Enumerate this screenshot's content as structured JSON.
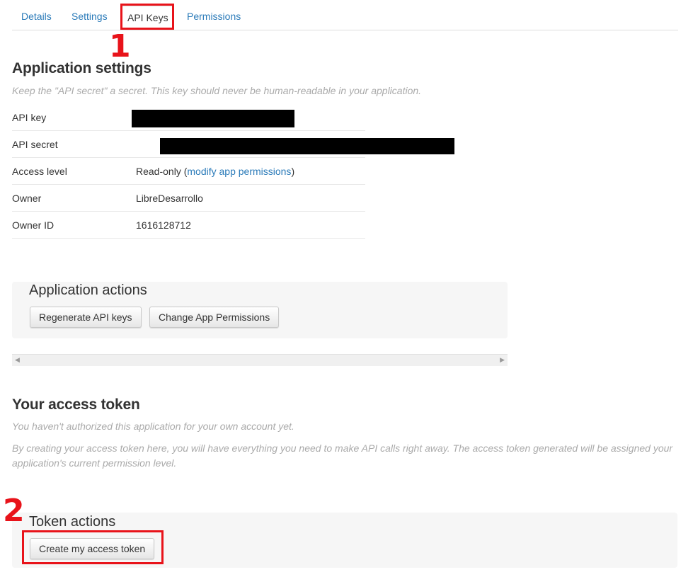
{
  "tabs": [
    {
      "label": "Details"
    },
    {
      "label": "Settings"
    },
    {
      "label": "API Keys",
      "active": true
    },
    {
      "label": "Permissions"
    }
  ],
  "annotations": {
    "step1": "1",
    "step2": "2"
  },
  "app_settings": {
    "title": "Application settings",
    "hint": "Keep the \"API secret\" a secret. This key should never be human-readable in your application.",
    "rows": {
      "api_key": {
        "label": "API key"
      },
      "api_secret": {
        "label": "API secret"
      },
      "access_level": {
        "label": "Access level",
        "value_prefix": "Read-only (",
        "link": "modify app permissions",
        "value_suffix": ")"
      },
      "owner": {
        "label": "Owner",
        "value": "LibreDesarrollo"
      },
      "owner_id": {
        "label": "Owner ID",
        "value": "1616128712"
      }
    }
  },
  "app_actions": {
    "title": "Application actions",
    "regenerate": "Regenerate API keys",
    "change_permissions": "Change App Permissions"
  },
  "access_token": {
    "title": "Your access token",
    "hint1": "You haven't authorized this application for your own account yet.",
    "hint2": "By creating your access token here, you will have everything you need to make API calls right away. The access token generated will be assigned your application's current permission level."
  },
  "token_actions": {
    "title": "Token actions",
    "create": "Create my access token"
  },
  "colors": {
    "accent_link": "#2b7bb9",
    "annotation_red": "#e8131a"
  }
}
